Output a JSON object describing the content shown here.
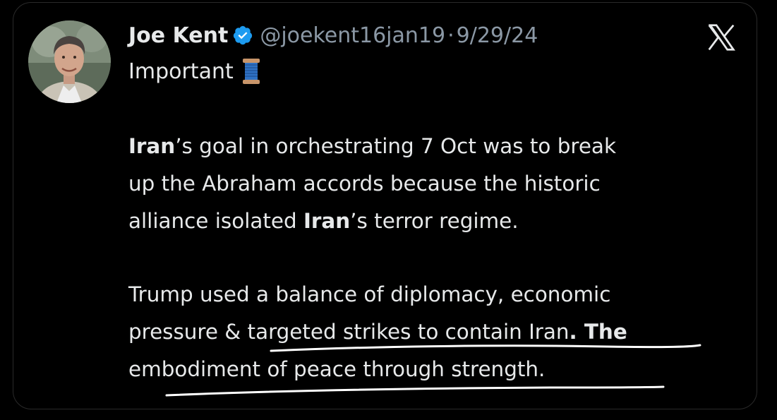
{
  "tweet": {
    "author_name": "Joe Kent",
    "handle": "@joekent16jan19",
    "separator": "·",
    "date": "9/29/24",
    "subtitle": "Important",
    "paragraph1": {
      "line1_bold": "Iran",
      "line1_rest": "’s goal in orchestrating 7 Oct was to break",
      "line2": "up the Abraham accords because the historic",
      "line3_pre": "alliance isolated ",
      "line3_bold": "Iran",
      "line3_post": "’s terror regime."
    },
    "paragraph2": {
      "line1": "Trump used a balance of diplomacy, economic",
      "line2_pre": "pressure & targeted strikes to contain Iran",
      "line2_bold": ". The",
      "line3": "embodiment of peace through strength."
    }
  },
  "icons": {
    "verified": "verified-badge-icon",
    "spool": "thread-spool-emoji",
    "x_logo": "x-logo-icon",
    "avatar": "profile-photo"
  },
  "colors": {
    "background": "#000000",
    "text": "#e7e9ea",
    "secondary_text": "#8b98a5",
    "verified_blue": "#1d9bf0",
    "underline": "#ffffff"
  }
}
